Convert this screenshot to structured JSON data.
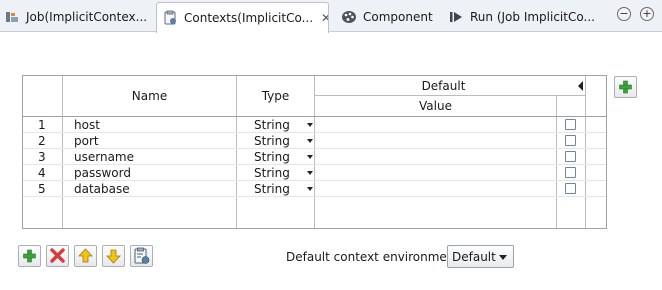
{
  "tabs": [
    {
      "label": "Job(ImplicitContex...",
      "icon": "job-icon"
    },
    {
      "label": "Contexts(ImplicitCo...",
      "icon": "contexts-icon",
      "active": true,
      "close": "✕"
    },
    {
      "label": "Component",
      "icon": "palette-icon"
    },
    {
      "label": "Run (Job ImplicitCo...",
      "icon": "run-icon"
    }
  ],
  "window_controls": {
    "minimize": "−",
    "maximize": "+"
  },
  "table": {
    "headers": {
      "name": "Name",
      "type": "Type",
      "default": "Default",
      "value": "Value"
    },
    "rows": [
      {
        "num": "1",
        "name": "host",
        "type": "String",
        "value": "",
        "prompt": false
      },
      {
        "num": "2",
        "name": "port",
        "type": "String",
        "value": "",
        "prompt": false
      },
      {
        "num": "3",
        "name": "username",
        "type": "String",
        "value": "",
        "prompt": false
      },
      {
        "num": "4",
        "name": "password",
        "type": "String",
        "value": "",
        "prompt": false
      },
      {
        "num": "5",
        "name": "database",
        "type": "String",
        "value": "",
        "prompt": false
      }
    ]
  },
  "toolbar": {
    "buttons": [
      "add-icon",
      "delete-icon",
      "move-up-icon",
      "move-down-icon",
      "manage-contexts-icon"
    ]
  },
  "context_env": {
    "label": "Default context environment",
    "selected": "Default"
  },
  "colors": {
    "add_green": "#3aa33a",
    "delete_red": "#d93a3a",
    "arrow_yellow": "#f0c419"
  }
}
